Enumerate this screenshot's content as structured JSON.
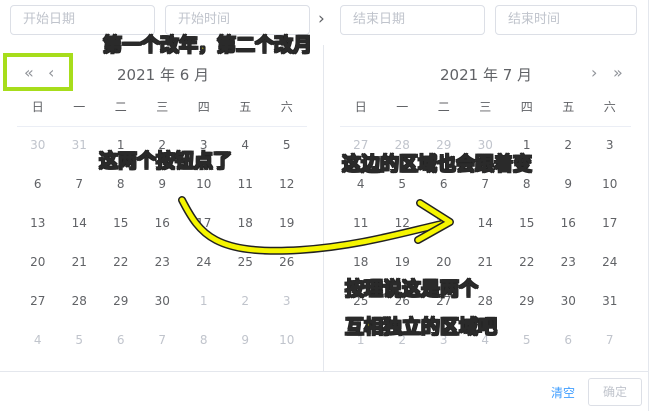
{
  "inputs": {
    "start_date": "开始日期",
    "start_time": "开始时间",
    "end_date": "结束日期",
    "end_time": "结束时间"
  },
  "left": {
    "title": "2021 年 6 月",
    "weekdays": [
      "日",
      "一",
      "二",
      "三",
      "四",
      "五",
      "六"
    ],
    "rows": [
      [
        "30",
        "31",
        "1",
        "2",
        "3",
        "4",
        "5"
      ],
      [
        "6",
        "7",
        "8",
        "9",
        "10",
        "11",
        "12"
      ],
      [
        "13",
        "14",
        "15",
        "16",
        "17",
        "18",
        "19"
      ],
      [
        "20",
        "21",
        "22",
        "23",
        "24",
        "25",
        "26"
      ],
      [
        "27",
        "28",
        "29",
        "30",
        "1",
        "2",
        "3"
      ],
      [
        "4",
        "5",
        "6",
        "7",
        "8",
        "9",
        "10"
      ]
    ]
  },
  "right": {
    "title": "2021 年 7 月",
    "weekdays": [
      "日",
      "一",
      "二",
      "三",
      "四",
      "五",
      "六"
    ],
    "rows": [
      [
        "27",
        "28",
        "29",
        "30",
        "1",
        "2",
        "3"
      ],
      [
        "4",
        "5",
        "6",
        "7",
        "8",
        "9",
        "10"
      ],
      [
        "11",
        "12",
        "13",
        "14",
        "15",
        "16",
        "17"
      ],
      [
        "18",
        "19",
        "20",
        "21",
        "22",
        "23",
        "24"
      ],
      [
        "25",
        "26",
        "27",
        "28",
        "29",
        "30",
        "31"
      ],
      [
        "1",
        "2",
        "3",
        "4",
        "5",
        "6",
        "7"
      ]
    ]
  },
  "footer": {
    "clear": "清空",
    "confirm": "确定"
  },
  "annotations": {
    "a1": "第一个改年，第二个改月",
    "a2": "这两个按钮点了",
    "a3": "这边的区域也会跟着变",
    "a4": "按理说这是两个",
    "a5": "互相独立的区域吧"
  },
  "icons": {
    "prev_year": "«",
    "prev_month": "‹",
    "next_month": "›",
    "next_year": "»",
    "sep_arrow": "›"
  },
  "colors": {
    "accent": "#409eff",
    "annotation": "#f2f200",
    "highlight": "#a7dd1b",
    "arrow": "#f5f500"
  }
}
